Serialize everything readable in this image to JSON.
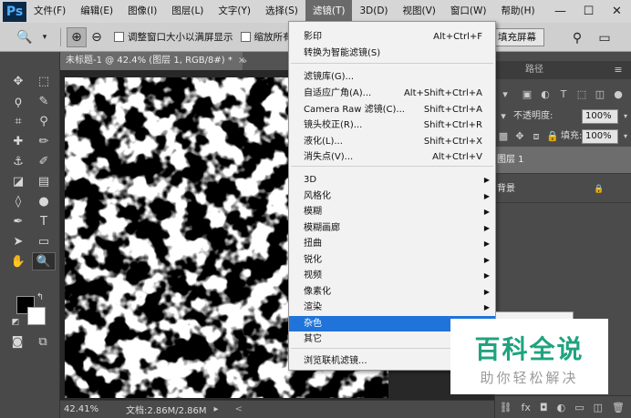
{
  "menubar": {
    "logo": "Ps",
    "items": [
      "文件(F)",
      "编辑(E)",
      "图像(I)",
      "图层(L)",
      "文字(Y)",
      "选择(S)",
      "滤镜(T)",
      "3D(D)",
      "视图(V)",
      "窗口(W)",
      "帮助(H)"
    ],
    "active_index": 6,
    "window_controls": [
      "—",
      "☐",
      "✕"
    ]
  },
  "optbar": {
    "resize_window_label": "调整窗口大小以满屏显示",
    "zoom_all_label": "缩放所有",
    "fill_screen_label": "填充屏幕"
  },
  "document": {
    "tab_title": "未标题-1 @ 42.4% (图层 1, RGB/8#) *",
    "tab_close": "×",
    "zoom": "42.41%",
    "doc_size": "文档:2.86M/2.86M"
  },
  "right_panel": {
    "paths_tab": "路径",
    "opacity_label": "不透明度:",
    "opacity_value": "100%",
    "fill_label": "填充:",
    "fill_value": "100%",
    "layers": [
      {
        "name": "图层 1"
      },
      {
        "name": "背景",
        "lock": "🔒"
      }
    ]
  },
  "filter_menu": {
    "items": [
      {
        "label": "影印",
        "shortcut": "Alt+Ctrl+F"
      },
      {
        "label": "转换为智能滤镜(S)",
        "shortcut": ""
      },
      {
        "label": "滤镜库(G)...",
        "shortcut": ""
      },
      {
        "label": "自适应广角(A)...",
        "shortcut": "Alt+Shift+Ctrl+A"
      },
      {
        "label": "Camera Raw 滤镜(C)...",
        "shortcut": "Shift+Ctrl+A"
      },
      {
        "label": "镜头校正(R)...",
        "shortcut": "Shift+Ctrl+R"
      },
      {
        "label": "液化(L)...",
        "shortcut": "Shift+Ctrl+X"
      },
      {
        "label": "消失点(V)...",
        "shortcut": "Alt+Ctrl+V"
      },
      {
        "label": "3D",
        "submenu": true
      },
      {
        "label": "风格化",
        "submenu": true
      },
      {
        "label": "模糊",
        "submenu": true
      },
      {
        "label": "模糊画廊",
        "submenu": true
      },
      {
        "label": "扭曲",
        "submenu": true
      },
      {
        "label": "锐化",
        "submenu": true
      },
      {
        "label": "视频",
        "submenu": true
      },
      {
        "label": "像素化",
        "submenu": true
      },
      {
        "label": "渲染",
        "submenu": true
      },
      {
        "label": "杂色",
        "submenu": true,
        "highlighted": true
      },
      {
        "label": "其它",
        "submenu": true
      },
      {
        "label": "浏览联机滤镜...",
        "shortcut": ""
      }
    ]
  },
  "watermark": {
    "title": "百科全说",
    "subtitle": "助你轻松解决"
  },
  "colors": {
    "highlight": "#1f73d9",
    "watermark_green": "#1fa37f"
  }
}
